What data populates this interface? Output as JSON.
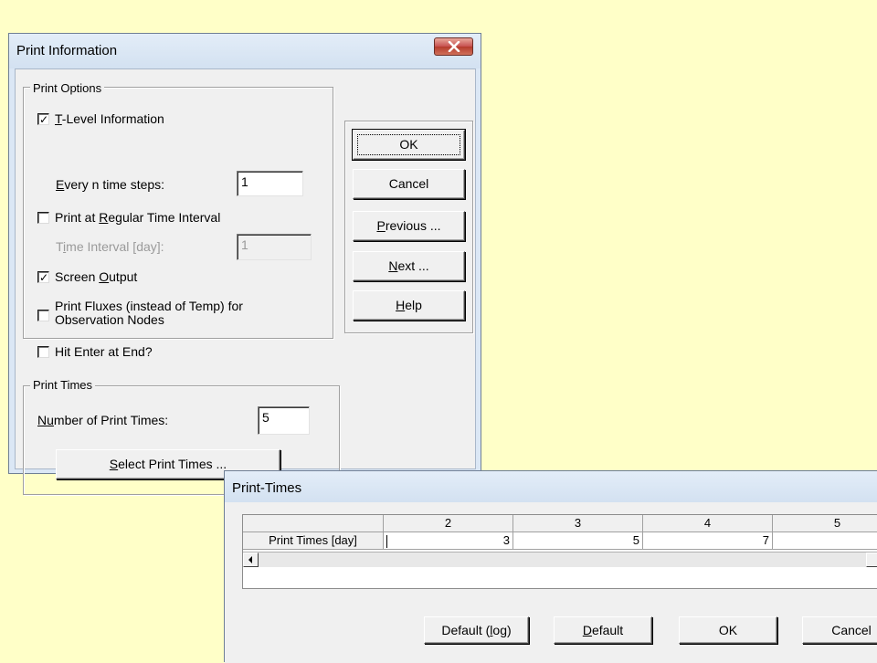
{
  "colors": {
    "desktop": "#ffffc8"
  },
  "print_info": {
    "title": "Print Information",
    "close_icon": "close-icon",
    "print_options": {
      "legend": "Print Options",
      "tlevel": {
        "checked": true,
        "pre": "",
        "key": "T",
        "post": "-Level Information"
      },
      "every_n": {
        "pre": "",
        "key": "E",
        "post": "very n time steps:",
        "value": "1"
      },
      "regular": {
        "checked": false,
        "pre": "Print at ",
        "key": "R",
        "post": "egular Time Interval"
      },
      "interval": {
        "pre": "T",
        "key": "i",
        "post": "me Interval [day]:",
        "value": "1"
      },
      "screen": {
        "checked": true,
        "pre": "Screen ",
        "key": "O",
        "post": "utput"
      },
      "fluxes": {
        "checked": false,
        "line1": "Print Fluxes (instead of Temp) for",
        "line2": "Observation Nodes"
      },
      "hit_enter": {
        "checked": false,
        "label": "Hit Enter at End?"
      }
    },
    "print_times": {
      "legend": "Print Times",
      "number": {
        "pre": "N",
        "key": "u",
        "post": "mber of Print Times:",
        "value": "5"
      },
      "select_btn": {
        "pre": "",
        "key": "S",
        "post": "elect Print Times ..."
      }
    },
    "buttons": {
      "ok": "OK",
      "cancel": "Cancel",
      "previous": {
        "pre": "",
        "key": "P",
        "post": "revious ..."
      },
      "next": {
        "pre": "",
        "key": "N",
        "post": "ext ..."
      },
      "help": {
        "pre": "",
        "key": "H",
        "post": "elp"
      }
    }
  },
  "print_times_dialog": {
    "title": "Print-Times",
    "grid": {
      "columns": [
        "",
        "2",
        "3",
        "4",
        "5"
      ],
      "row_label": "Print Times [day]",
      "values": [
        "3",
        "5",
        "7",
        ""
      ]
    },
    "buttons": {
      "default_log": {
        "pre": "Default (",
        "key": "l",
        "post": "og)"
      },
      "default": {
        "pre": "",
        "key": "D",
        "post": "efault"
      },
      "ok": "OK",
      "cancel": "Cancel"
    }
  }
}
